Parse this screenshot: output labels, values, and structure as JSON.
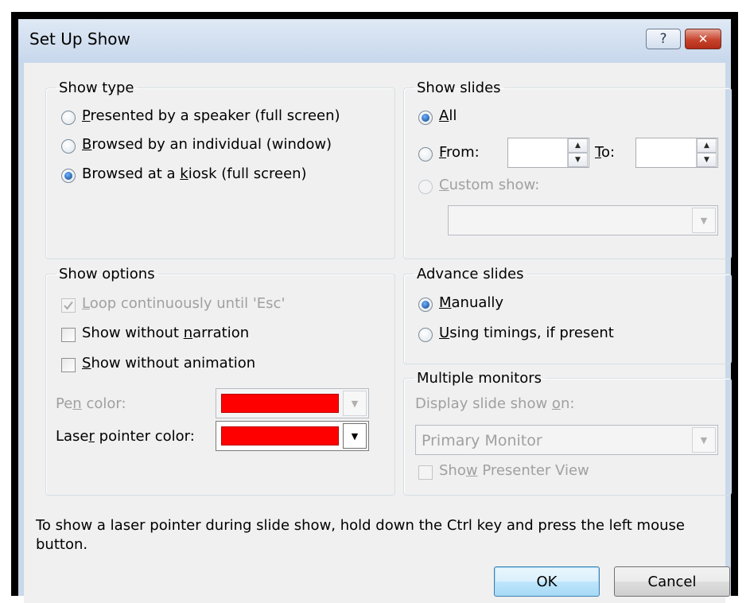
{
  "window": {
    "title": "Set Up Show",
    "help_glyph": "?",
    "close_glyph": "✕"
  },
  "show_type": {
    "legend": "Show type",
    "options": [
      {
        "pre": "",
        "ul": "P",
        "post": "resented by a speaker (full screen)",
        "selected": false
      },
      {
        "pre": "",
        "ul": "B",
        "post": "rowsed by an individual (window)",
        "selected": false
      },
      {
        "pre": "Browsed at a ",
        "ul": "k",
        "post": "iosk (full screen)",
        "selected": true
      }
    ]
  },
  "show_slides": {
    "legend": "Show slides",
    "all": {
      "pre": "",
      "ul": "A",
      "post": "ll",
      "selected": true
    },
    "from": {
      "pre": "",
      "ul": "F",
      "post": "rom:",
      "selected": false,
      "value": ""
    },
    "to": {
      "pre": "",
      "ul": "T",
      "post": "o:",
      "value": ""
    },
    "custom": {
      "pre": "",
      "ul": "C",
      "post": "ustom show:",
      "selected": false,
      "enabled": false,
      "value": ""
    }
  },
  "show_options": {
    "legend": "Show options",
    "loop": {
      "pre": "",
      "ul": "L",
      "post": "oop continuously until 'Esc'",
      "checked": true,
      "enabled": false
    },
    "narration": {
      "pre": "Show without ",
      "ul": "n",
      "post": "arration",
      "checked": false
    },
    "animation": {
      "pre": "",
      "ul": "S",
      "post": "how without animation",
      "checked": false
    },
    "pen_color": {
      "pre": "Pe",
      "ul": "n",
      "post": " color:",
      "value": "#ff0000",
      "enabled": false
    },
    "laser_color": {
      "pre": "Lase",
      "ul": "r",
      "post": " pointer color:",
      "value": "#ff0000",
      "enabled": true
    }
  },
  "advance_slides": {
    "legend": "Advance slides",
    "manually": {
      "pre": "",
      "ul": "M",
      "post": "anually",
      "selected": true
    },
    "timings": {
      "pre": "",
      "ul": "U",
      "post": "sing timings, if present",
      "selected": false
    }
  },
  "multiple_monitors": {
    "legend": "Multiple monitors",
    "display_label": {
      "pre": "Display slide show ",
      "ul": "o",
      "post": "n:"
    },
    "display_value": "Primary Monitor",
    "presenter_view": {
      "pre": "Sho",
      "ul": "w",
      "post": " Presenter View",
      "checked": false,
      "enabled": false
    }
  },
  "hint": "To show a laser pointer during slide show, hold down the Ctrl key and press the left mouse button.",
  "buttons": {
    "ok": "OK",
    "cancel": "Cancel"
  }
}
